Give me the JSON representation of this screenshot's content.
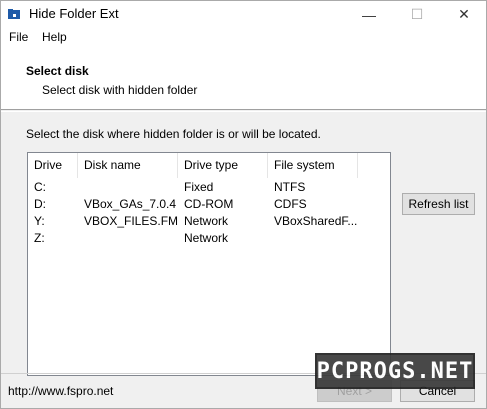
{
  "window": {
    "title": "Hide Folder Ext",
    "minimize_glyph": "—",
    "maximize_glyph": "☐",
    "close_glyph": "✕"
  },
  "menu": {
    "items": [
      {
        "label": "File"
      },
      {
        "label": "Help"
      }
    ]
  },
  "header": {
    "title": "Select disk",
    "subtitle": "Select disk with hidden folder"
  },
  "instruction": "Select the disk where hidden folder is or will be located.",
  "disk_list": {
    "columns": [
      "Drive",
      "Disk name",
      "Drive type",
      "File system"
    ],
    "rows": [
      {
        "drive": "C:",
        "name": "",
        "type": "Fixed",
        "fs": "NTFS"
      },
      {
        "drive": "D:",
        "name": "VBox_GAs_7.0.4",
        "type": "CD-ROM",
        "fs": "CDFS"
      },
      {
        "drive": "Y:",
        "name": "VBOX_FILES.FM",
        "type": "Network",
        "fs": "VBoxSharedF..."
      },
      {
        "drive": "Z:",
        "name": "",
        "type": "Network",
        "fs": ""
      }
    ]
  },
  "buttons": {
    "refresh": "Refresh list",
    "next": "Next >",
    "cancel": "Cancel"
  },
  "footer": {
    "link": "http://www.fspro.net"
  },
  "watermark": "PCPROGS.NET",
  "colors": {
    "accent": "#1e5aa8",
    "window_bg": "#f0f0f0"
  }
}
